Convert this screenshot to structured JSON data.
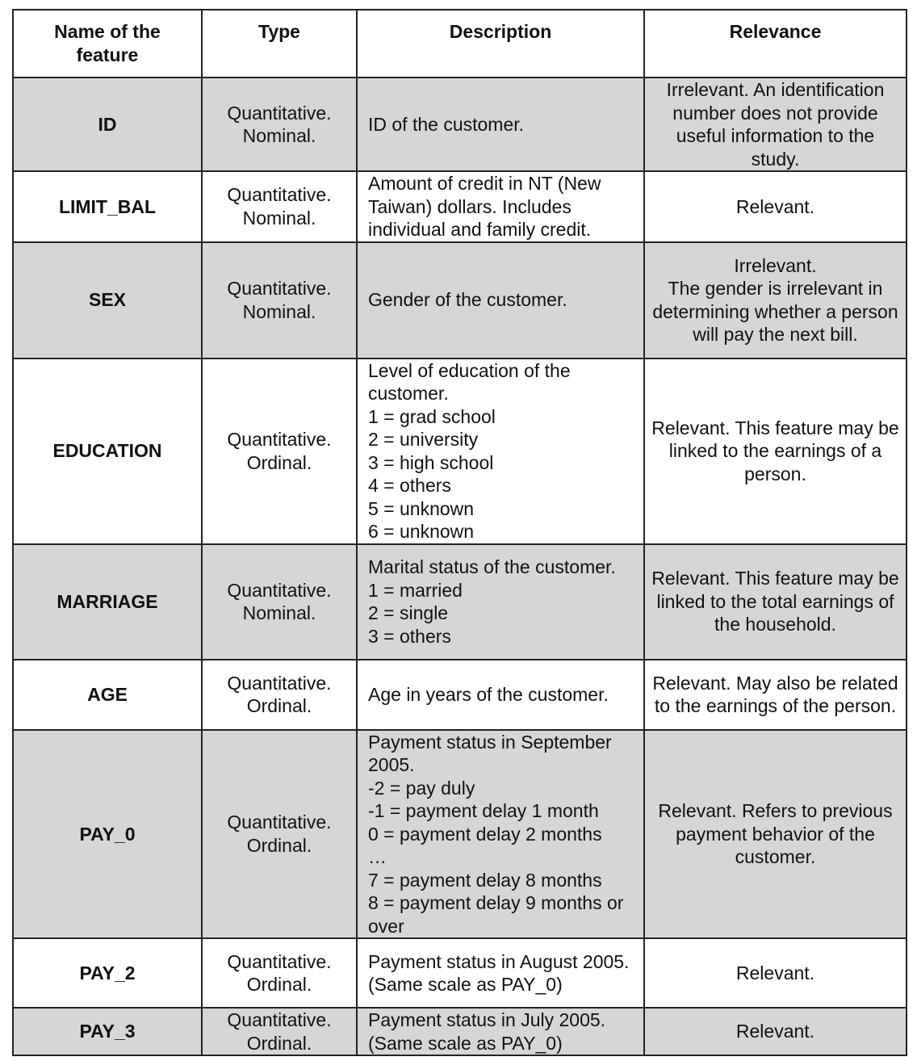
{
  "headers": [
    "Name of the\nfeature",
    "Type",
    "Description",
    "Relevance"
  ],
  "rows": [
    {
      "name": "ID",
      "type": "Quantitative.\nNominal.",
      "description": "ID of the customer.",
      "relevance": "Irrelevant. An identification number does not provide useful information to the study.",
      "shaded": true
    },
    {
      "name": "LIMIT_BAL",
      "type": "Quantitative.\nNominal.",
      "description": "Amount of credit in NT (New Taiwan) dollars. Includes individual and family credit.",
      "relevance": "Relevant.",
      "shaded": false
    },
    {
      "name": "SEX",
      "type": "Quantitative.\nNominal.",
      "description": "Gender of the customer.",
      "relevance": "Irrelevant.\nThe gender is irrelevant in determining whether a person will pay the next bill.",
      "shaded": true
    },
    {
      "name": "EDUCATION",
      "type": "Quantitative.\nOrdinal.",
      "description": "Level of education of the customer.\n1 = grad school\n2 = university\n3 = high school\n4 = others\n5 = unknown\n6 = unknown",
      "relevance": "Relevant. This feature may be linked to the earnings of a person.",
      "shaded": false
    },
    {
      "name": "MARRIAGE",
      "type": "Quantitative.\nNominal.",
      "description": "Marital status of the customer.\n1 = married\n2 = single\n3 = others",
      "relevance": "Relevant. This feature may be linked to the total earnings of the household.",
      "shaded": true
    },
    {
      "name": "AGE",
      "type": "Quantitative.\nOrdinal.",
      "description": "Age in years of the customer.",
      "relevance": "Relevant. May also be related to the earnings of the person.",
      "shaded": false
    },
    {
      "name": "PAY_0",
      "type": "Quantitative.\nOrdinal.",
      "description": "Payment status in September 2005.\n-2 = pay duly\n-1 = payment delay 1 month\n0 = payment delay 2 months\n…\n7 = payment delay 8 months\n8 = payment delay 9 months or over",
      "relevance": "Relevant. Refers to previous payment behavior of the customer.",
      "shaded": true
    },
    {
      "name": "PAY_2",
      "type": "Quantitative.\nOrdinal.",
      "description": "Payment status in August 2005.\n(Same scale as PAY_0)",
      "relevance": "Relevant.",
      "shaded": false
    },
    {
      "name": "PAY_3",
      "type": "Quantitative.\nOrdinal.",
      "description": "Payment status in July 2005.\n(Same scale as PAY_0)",
      "relevance": "Relevant.",
      "shaded": true
    }
  ]
}
